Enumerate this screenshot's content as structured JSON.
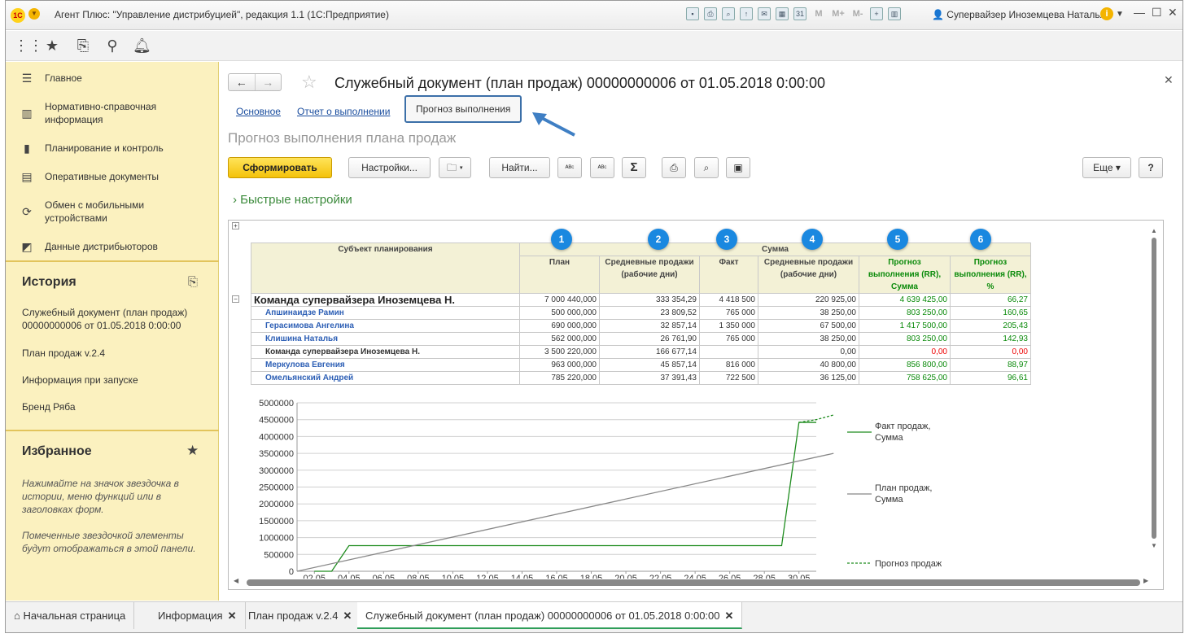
{
  "window": {
    "title": "Агент Плюс: \"Управление дистрибуцией\", редакция 1.1  (1С:Предприятие)",
    "logo_text": "1С",
    "user": "Супервайзер Иноземцева Наталья",
    "m_buttons": [
      "M",
      "M+",
      "M-"
    ]
  },
  "sidebar": {
    "sections": [
      {
        "label": "Главное",
        "icon": "menu-icon"
      },
      {
        "label": "Нормативно-справочная информация",
        "icon": "catalog-icon"
      },
      {
        "label": "Планирование и контроль",
        "icon": "chart-icon"
      },
      {
        "label": "Оперативные документы",
        "icon": "documents-icon"
      },
      {
        "label": "Обмен с мобильными устройствами",
        "icon": "sync-icon"
      },
      {
        "label": "Данные дистрибьюторов",
        "icon": "distributor-icon"
      }
    ],
    "history": {
      "title": "История",
      "items": [
        "Служебный документ (план продаж) 00000000006 от 01.05.2018 0:00:00",
        "План продаж v.2.4",
        "Информация при запуске",
        "Бренд Ряба"
      ]
    },
    "favorites": {
      "title": "Избранное",
      "text1": "Нажимайте на значок звездочка в истории, меню функций или в заголовках форм.",
      "text2": "Помеченные звездочкой элементы будут отображаться в этой панели."
    }
  },
  "document": {
    "title": "Служебный документ (план продаж) 00000000006 от 01.05.2018 0:00:00",
    "tabs": [
      "Основное",
      "Отчет о выполнении",
      "Прогноз выполнения"
    ],
    "subtitle": "Прогноз выполнения плана продаж",
    "buttons": {
      "generate": "Сформировать",
      "settings": "Настройки...",
      "find": "Найти...",
      "more": "Еще",
      "help": "?",
      "sum": "Σ"
    },
    "quick_settings": "Быстрые настройки"
  },
  "table": {
    "subject_header": "Субъект планирования",
    "group_header": "Сумма",
    "columns": [
      "План",
      "Средневные продажи (рабочие дни)",
      "Факт",
      "Средневные продажи (рабочие дни)",
      "Прогноз выполнения (RR), Сумма",
      "Прогноз выполнения (RR), %"
    ],
    "badges": [
      "1",
      "2",
      "3",
      "4",
      "5",
      "6"
    ],
    "rows": [
      {
        "name": "Команда супервайзера  Иноземцева Н.",
        "kind": "top",
        "plan": "7 000 440,000",
        "avg1": "333 354,29",
        "fact": "4 418 500",
        "avg2": "220 925,00",
        "fsum": "4 639 425,00",
        "fpct": "66,27"
      },
      {
        "name": "Апшинаидзе Рамин",
        "kind": "name",
        "plan": "500 000,000",
        "avg1": "23 809,52",
        "fact": "765 000",
        "avg2": "38 250,00",
        "fsum": "803 250,00",
        "fpct": "160,65"
      },
      {
        "name": "Герасимова Ангелина",
        "kind": "name",
        "plan": "690 000,000",
        "avg1": "32 857,14",
        "fact": "1 350 000",
        "avg2": "67 500,00",
        "fsum": "1 417 500,00",
        "fpct": "205,43"
      },
      {
        "name": "Клишина Наталья",
        "kind": "name",
        "plan": "562 000,000",
        "avg1": "26 761,90",
        "fact": "765 000",
        "avg2": "38 250,00",
        "fsum": "803 250,00",
        "fpct": "142,93"
      },
      {
        "name": "Команда супервайзера  Иноземцева Н.",
        "kind": "team",
        "plan": "3 500 220,000",
        "avg1": "166 677,14",
        "fact": "",
        "avg2": "0,00",
        "fsum": "0,00",
        "fpct": "0,00",
        "red": true
      },
      {
        "name": "Меркулова Евгения",
        "kind": "name",
        "plan": "963 000,000",
        "avg1": "45 857,14",
        "fact": "816 000",
        "avg2": "40 800,00",
        "fsum": "856 800,00",
        "fpct": "88,97"
      },
      {
        "name": "Омельянский Андрей",
        "kind": "name",
        "plan": "785 220,000",
        "avg1": "37 391,43",
        "fact": "722 500",
        "avg2": "36 125,00",
        "fsum": "758 625,00",
        "fpct": "96,61"
      }
    ]
  },
  "chart_data": {
    "type": "line",
    "x": [
      "01.05",
      "02.05",
      "03.05",
      "04.05",
      "05.05",
      "06.05",
      "07.05",
      "08.05",
      "09.05",
      "10.05",
      "11.05",
      "12.05",
      "13.05",
      "14.05",
      "15.05",
      "16.05",
      "17.05",
      "18.05",
      "19.05",
      "20.05",
      "21.05",
      "22.05",
      "23.05",
      "24.05",
      "25.05",
      "26.05",
      "27.05",
      "28.05",
      "29.05",
      "30.05",
      "31.05"
    ],
    "xticks": [
      "02.05",
      "04.05",
      "06.05",
      "08.05",
      "10.05",
      "12.05",
      "14.05",
      "16.05",
      "18.05",
      "20.05",
      "22.05",
      "24.05",
      "26.05",
      "28.05",
      "30.05"
    ],
    "yticks": [
      0,
      500000,
      1000000,
      1500000,
      2000000,
      2500000,
      3000000,
      3500000,
      4000000,
      4500000,
      5000000
    ],
    "ylim": [
      0,
      5000000
    ],
    "series": [
      {
        "name": "Факт продаж, Сумма",
        "color": "#1e8c1e",
        "style": "solid",
        "points": [
          [
            1,
            0
          ],
          [
            2,
            0
          ],
          [
            3,
            760000
          ],
          [
            28,
            760000
          ],
          [
            29,
            4418500
          ],
          [
            30,
            4418500
          ]
        ]
      },
      {
        "name": "План продаж, Сумма",
        "color": "#888888",
        "style": "solid",
        "points": [
          [
            0,
            0
          ],
          [
            31,
            3500000
          ]
        ]
      },
      {
        "name": "Прогноз продаж",
        "color": "#1e8c1e",
        "style": "dashed",
        "points": [
          [
            29,
            4418500
          ],
          [
            30,
            4500000
          ],
          [
            31,
            4639425
          ]
        ]
      }
    ],
    "legend": "right"
  },
  "bottom_tabs": [
    {
      "label": "Начальная страница",
      "close": false,
      "active": false
    },
    {
      "label": "Информация",
      "close": true,
      "active": false
    },
    {
      "label": "План продаж v.2.4",
      "close": true,
      "active": false
    },
    {
      "label": "Служебный документ (план продаж) 00000000006 от 01.05.2018 0:00:00",
      "close": true,
      "active": true
    }
  ]
}
